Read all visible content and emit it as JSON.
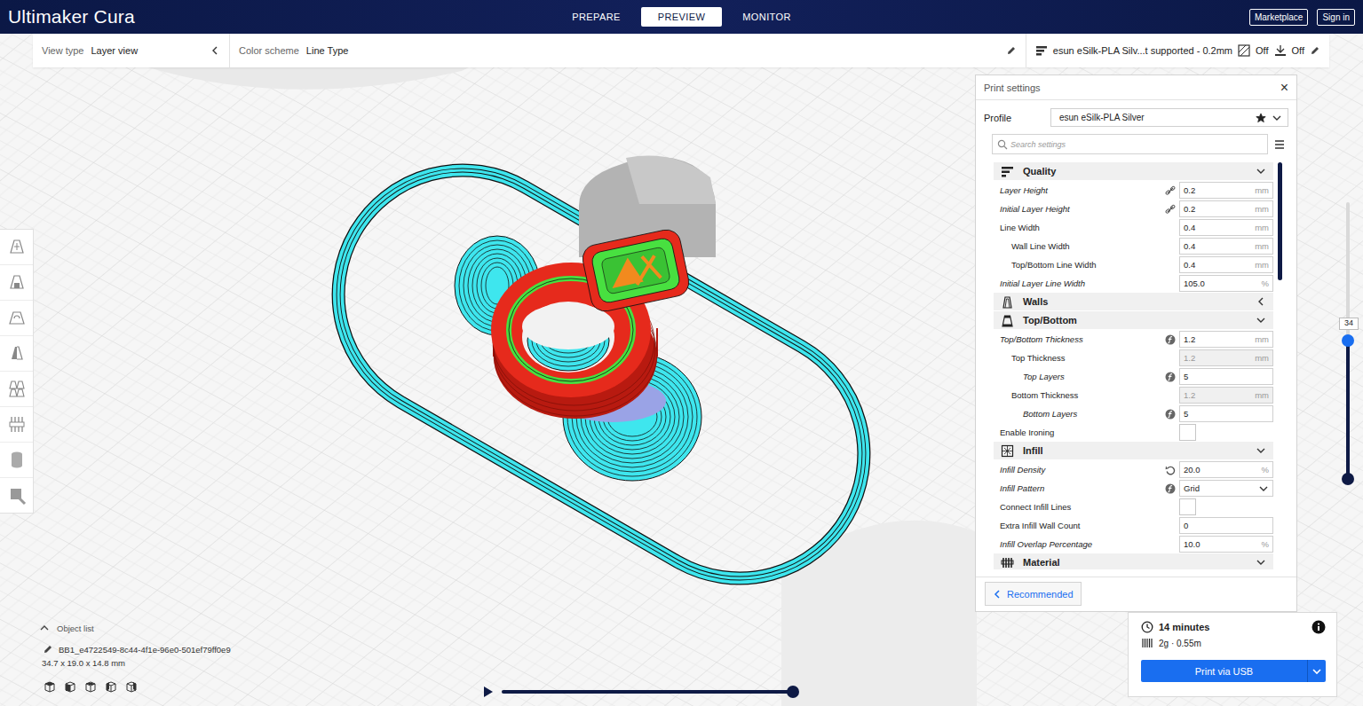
{
  "app": {
    "title": "Ultimaker Cura"
  },
  "stages": [
    {
      "label": "PREPARE",
      "selected": false
    },
    {
      "label": "PREVIEW",
      "selected": true
    },
    {
      "label": "MONITOR",
      "selected": false
    }
  ],
  "header_buttons": [
    {
      "label": "Marketplace"
    },
    {
      "label": "Sign in"
    }
  ],
  "view_bar": {
    "view_type_label": "View type",
    "view_type": "Layer view",
    "color_scheme_label": "Color scheme",
    "color_scheme": "Line Type",
    "print_setup": "esun eSilk-PLA Silv...t supported - 0.2mm",
    "support": "Off",
    "adhesion": "Off"
  },
  "print_settings": {
    "title": "Print settings",
    "close": "×",
    "profile_label": "Profile",
    "profile": "esun eSilk-PLA Silver",
    "profile_starred": true,
    "search_placeholder": "Search settings",
    "scrollbar": {
      "level": 0.29
    },
    "rows": [
      {
        "kind": "category",
        "label": "Quality",
        "expanded": true
      },
      {
        "kind": "number",
        "label": "Layer Height",
        "value": "0.2",
        "unit": "mm",
        "depth": 0,
        "overridden": true,
        "disabled": false,
        "marker": "link"
      },
      {
        "kind": "number",
        "label": "Initial Layer Height",
        "value": "0.2",
        "unit": "mm",
        "depth": 0,
        "overridden": true,
        "disabled": false,
        "marker": "link"
      },
      {
        "kind": "number",
        "label": "Line Width",
        "value": "0.4",
        "unit": "mm",
        "depth": 0,
        "overridden": false,
        "disabled": false,
        "marker": "none"
      },
      {
        "kind": "number",
        "label": "Wall Line Width",
        "value": "0.4",
        "unit": "mm",
        "depth": 1,
        "overridden": false,
        "disabled": false,
        "marker": "none"
      },
      {
        "kind": "number",
        "label": "Top/Bottom Line Width",
        "value": "0.4",
        "unit": "mm",
        "depth": 1,
        "overridden": false,
        "disabled": false,
        "marker": "none"
      },
      {
        "kind": "number",
        "label": "Initial Layer Line Width",
        "value": "105.0",
        "unit": "%",
        "depth": 0,
        "overridden": true,
        "disabled": false,
        "marker": "none"
      },
      {
        "kind": "category",
        "label": "Walls",
        "expanded": false
      },
      {
        "kind": "category",
        "label": "Top/Bottom",
        "expanded": true
      },
      {
        "kind": "number",
        "label": "Top/Bottom Thickness",
        "value": "1.2",
        "unit": "mm",
        "depth": 0,
        "overridden": true,
        "disabled": false,
        "marker": "function"
      },
      {
        "kind": "number",
        "label": "Top Thickness",
        "value": "1.2",
        "unit": "mm",
        "depth": 1,
        "overridden": false,
        "disabled": true,
        "marker": "none"
      },
      {
        "kind": "number",
        "label": "Top Layers",
        "value": "5",
        "unit": "",
        "depth": 2,
        "overridden": true,
        "disabled": false,
        "marker": "function"
      },
      {
        "kind": "number",
        "label": "Bottom Thickness",
        "value": "1.2",
        "unit": "mm",
        "depth": 1,
        "overridden": false,
        "disabled": true,
        "marker": "none"
      },
      {
        "kind": "number",
        "label": "Bottom Layers",
        "value": "5",
        "unit": "",
        "depth": 2,
        "overridden": true,
        "disabled": false,
        "marker": "function"
      },
      {
        "kind": "checkbox",
        "label": "Enable Ironing",
        "checked": false,
        "depth": 0,
        "overridden": false,
        "marker": "none"
      },
      {
        "kind": "category",
        "label": "Infill",
        "expanded": true
      },
      {
        "kind": "number",
        "label": "Infill Density",
        "value": "20.0",
        "unit": "%",
        "depth": 0,
        "overridden": true,
        "disabled": false,
        "marker": "reset"
      },
      {
        "kind": "select",
        "label": "Infill Pattern",
        "value": "Grid",
        "depth": 0,
        "overridden": true,
        "marker": "function"
      },
      {
        "kind": "checkbox",
        "label": "Connect Infill Lines",
        "checked": false,
        "depth": 0,
        "overridden": false,
        "marker": "none"
      },
      {
        "kind": "number",
        "label": "Extra Infill Wall Count",
        "value": "0",
        "unit": "",
        "depth": 0,
        "overridden": false,
        "disabled": false,
        "marker": "none"
      },
      {
        "kind": "number",
        "label": "Infill Overlap Percentage",
        "value": "10.0",
        "unit": "%",
        "depth": 0,
        "overridden": true,
        "disabled": false,
        "marker": "none"
      },
      {
        "kind": "category",
        "label": "Material",
        "expanded": true
      }
    ],
    "mode_button": "Recommended"
  },
  "layer_slider": {
    "value": "34",
    "level": 0.5
  },
  "simulation": {
    "level": 1.0
  },
  "estimate": {
    "time": "14 minutes",
    "material": "2g · 0.55m",
    "print_button": "Print via USB"
  },
  "object_list": {
    "title": "Object list",
    "expanded": true,
    "name": "BB1_e4722549-8c44-4f1e-96e0-501ef79ff0e9",
    "dimensions": "34.7 x 19.0 x 14.8 mm"
  }
}
